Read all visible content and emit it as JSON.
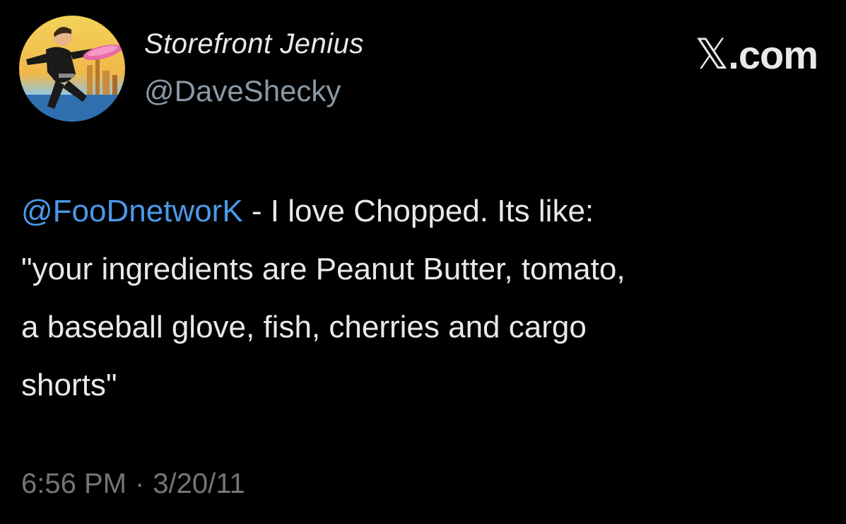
{
  "author": {
    "display_name": "Storefront Jenius",
    "handle": "@DaveShecky",
    "avatar_icon": "avatar-illustration"
  },
  "brand": {
    "logo_text": ".com",
    "logo_mark": "𝕏",
    "logo_icon": "x-logo-icon"
  },
  "tweet": {
    "mention": "@FooDnetworK",
    "line1_rest": " - I love Chopped. Its like:",
    "line2": "\"your ingredients are Peanut Butter, tomato,",
    "line3": "a baseball glove, fish, cherries and cargo",
    "line4": "shorts\""
  },
  "meta": {
    "time": "6:56 PM",
    "separator": "·",
    "date": "3/20/11"
  },
  "colors": {
    "background": "#000000",
    "text": "#e7e9ea",
    "mention": "#4a99e9",
    "secondary": "#71767b"
  }
}
